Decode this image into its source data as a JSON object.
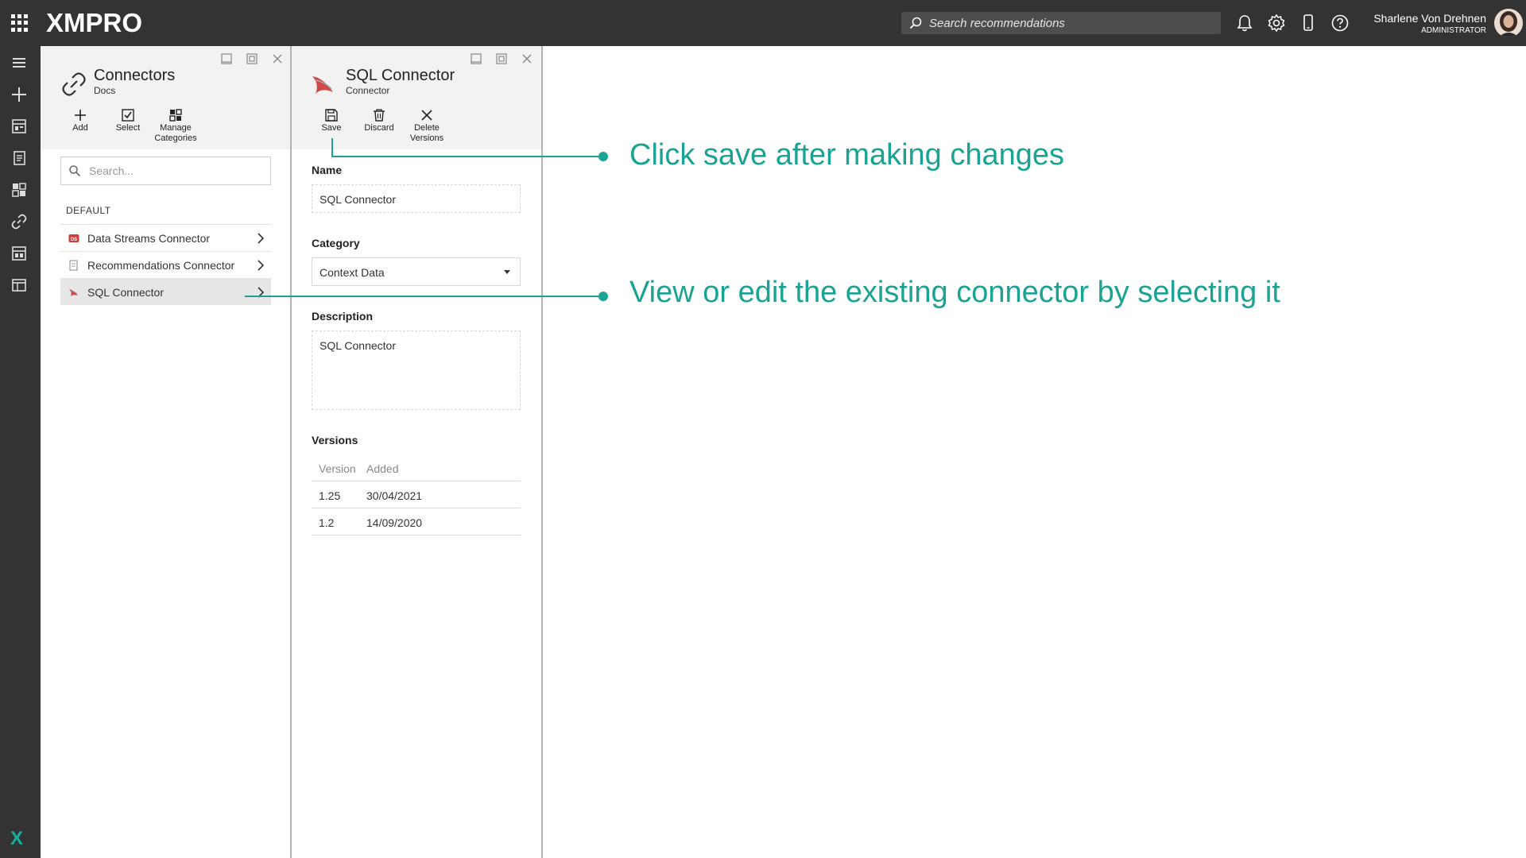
{
  "topbar": {
    "logo": "XMPRO",
    "search_placeholder": "Search recommendations",
    "user_name": "Sharlene Von Drehnen",
    "user_role": "ADMINISTRATOR",
    "icons": [
      "bell-icon",
      "gear-icon",
      "mobile-icon",
      "help-icon"
    ]
  },
  "leftnav": {
    "items": [
      "menu-icon",
      "plus-icon",
      "dashboard-icon",
      "recommendation-icon",
      "apps-icon",
      "connectors-icon",
      "data-streams-icon",
      "integration-icon"
    ],
    "brand": "X"
  },
  "connectors_panel": {
    "title": "Connectors",
    "subtitle": "Docs",
    "toolbar": {
      "add_label": "Add",
      "select_label": "Select",
      "manage_label_line1": "Manage",
      "manage_label_line2": "Categories"
    },
    "search_placeholder": "Search...",
    "group_title": "DEFAULT",
    "items": [
      {
        "label": "Data Streams Connector",
        "icon": "data-streams-badge-icon"
      },
      {
        "label": "Recommendations Connector",
        "icon": "recommendation-doc-icon"
      },
      {
        "label": "SQL Connector",
        "icon": "sql-server-icon",
        "selected": true
      }
    ]
  },
  "detail_panel": {
    "title": "SQL Connector",
    "subtitle": "Connector",
    "toolbar": {
      "save_label": "Save",
      "discard_label": "Discard",
      "delete_label_line1": "Delete",
      "delete_label_line2": "Versions"
    },
    "name_label": "Name",
    "name_value": "SQL Connector",
    "category_label": "Category",
    "category_value": "Context Data",
    "description_label": "Description",
    "description_value": "SQL Connector",
    "versions_label": "Versions",
    "versions_headers": [
      "Version",
      "Added"
    ],
    "versions": [
      {
        "version": "1.25",
        "added": "30/04/2021"
      },
      {
        "version": "1.2",
        "added": "14/09/2020"
      }
    ]
  },
  "annotations": {
    "save_hint": "Click save after making changes",
    "select_hint": "View or edit the existing connector by selecting it",
    "color": "#1aa392"
  }
}
